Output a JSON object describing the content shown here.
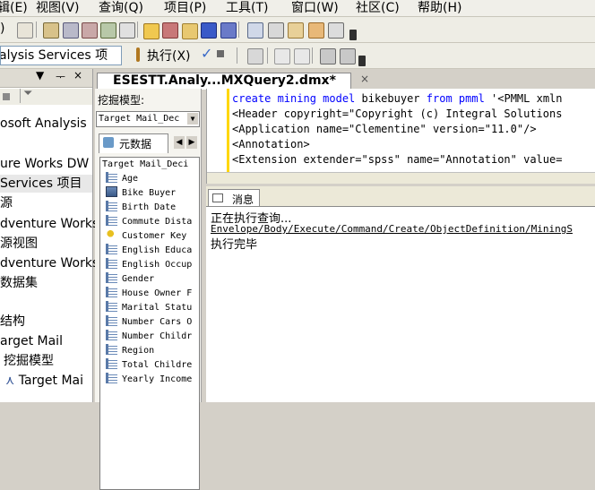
{
  "menu": {
    "items": [
      "辑(E)",
      "视图(V)",
      "查询(Q)",
      "项目(P)",
      "工具(T)",
      "窗口(W)",
      "社区(C)",
      "帮助(H)"
    ]
  },
  "toolbar2": {
    "server_type": "alysis Services 项",
    "execute_label": "执行(X)"
  },
  "left_panel": {
    "items": [
      "osoft Analysis",
      "ure Works DW",
      "Services 项目",
      "源",
      "dventure Works",
      "源视图",
      "dventure Works",
      "数据集",
      "结构",
      "arget Mail",
      "挖掘模型",
      "Target Mai"
    ]
  },
  "document": {
    "tab_title": "ESESTT.Analy...MXQuery2.dmx*"
  },
  "miner": {
    "model_label": "挖掘模型:",
    "model_value": "Target Mail_Dec",
    "metadata_tab": "元数据",
    "tree_root": "Target Mail_Deci",
    "columns": [
      "Age",
      "Bike Buyer",
      "Birth Date",
      "Commute Dista",
      "Customer Key",
      "English Educa",
      "English Occup",
      "Gender",
      "House Owner F",
      "Marital Statu",
      "Number Cars O",
      "Number Childr",
      "Region",
      "Total Childre",
      "Yearly Income"
    ]
  },
  "editor": {
    "line1_kw1": "create mining model",
    "line1_mid": " bikebuyer ",
    "line1_kw2": "from pmml",
    "line1_rest": " '<PMML xmln",
    "line2": "<Header copyright=\"Copyright (c) Integral Solutions",
    "line3": "<Application name=\"Clementine\" version=\"11.0\"/>",
    "line4": "<Annotation>",
    "line5": "<Extension extender=\"spss\" name=\"Annotation\" value="
  },
  "messages": {
    "tab_label": "消息",
    "line1": "正在执行查询...",
    "line2": "Envelope/Body/Execute/Command/Create/ObjectDefinition/MiningS",
    "line3": "执行完毕"
  }
}
